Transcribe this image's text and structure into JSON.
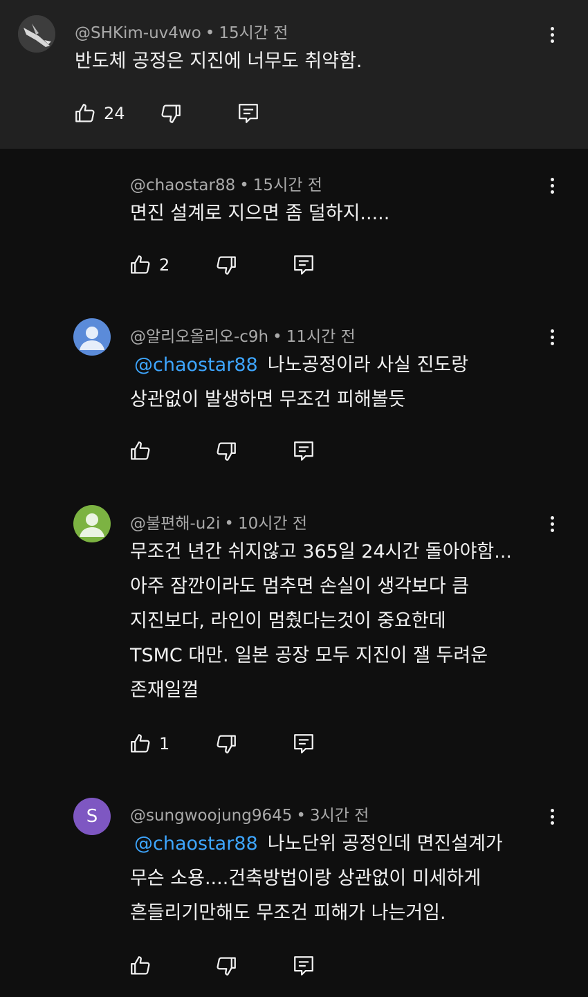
{
  "comments": [
    {
      "author": "@SHKim-uv4wo",
      "time": "15시간 전",
      "text_lines": [
        "반도체 공정은 지진에 너무도 취약함."
      ],
      "likes": "24",
      "avatar": "bird-photo"
    },
    {
      "author": "@chaostar88",
      "time": "15시간 전",
      "text_lines": [
        "면진 설계로 지으면 좀 덜하지....."
      ],
      "likes": "2"
    },
    {
      "author": "@알리오올리오-c9h",
      "time": "11시간 전",
      "mention": "@chaostar88",
      "text_lines": [
        "나노공정이라 사실 진도랑",
        "상관없이 발생하면 무조건 피해볼듯"
      ],
      "likes": "",
      "avatar_color": "#5b8bd9"
    },
    {
      "author": "@불편해-u2i",
      "time": "10시간 전",
      "text_lines": [
        "무조건 년간 쉬지않고 365일 24시간 돌아야함...",
        "아주 잠깐이라도 멈추면 손실이 생각보다 큼",
        "지진보다, 라인이 멈췄다는것이 중요한데",
        "TSMC 대만. 일본 공장 모두 지진이 잴 두려운",
        "존재일껄"
      ],
      "likes": "1",
      "avatar_color": "#7cb342"
    },
    {
      "author": "@sungwoojung9645",
      "time": "3시간 전",
      "mention": "@chaostar88",
      "text_lines": [
        "나노단위 공정인데 면진설계가",
        "무슨 소용....건축방법이랑 상관없이 미세하게",
        "흔들리기만해도 무조건 피해가 나는거임."
      ],
      "likes": "",
      "avatar_letter": "S",
      "avatar_color": "#7e57c2"
    }
  ],
  "icons": {
    "like": "thumbs-up-icon",
    "dislike": "thumbs-down-icon",
    "reply": "reply-icon",
    "more": "more-vert-icon"
  }
}
